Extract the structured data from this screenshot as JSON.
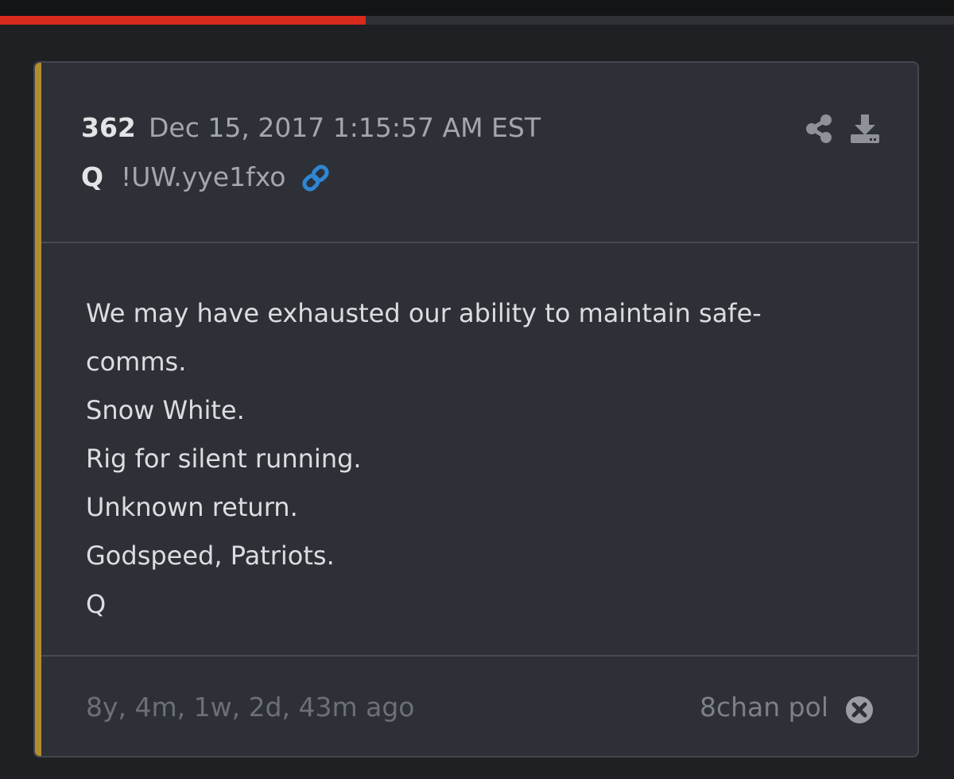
{
  "progress": {
    "fraction": 0.383,
    "fill_color": "#d82a1c"
  },
  "post": {
    "number": "362",
    "date": "Dec 15, 2017 1:15:57 AM EST",
    "author": "Q",
    "tripcode": "!UW.yye1fxo",
    "accent_color": "#b08e2f",
    "link_icon": "link-icon",
    "share_icon": "share-icon",
    "download_icon": "download-icon",
    "lines": [
      "We may have exhausted our ability to maintain safe-",
      "comms.",
      "Snow White.",
      "Rig for silent running.",
      "Unknown return.",
      "Godspeed, Patriots.",
      "Q"
    ],
    "age": "8y, 4m, 1w, 2d, 43m ago",
    "source": "8chan pol",
    "close_icon": "close-circle-icon"
  }
}
